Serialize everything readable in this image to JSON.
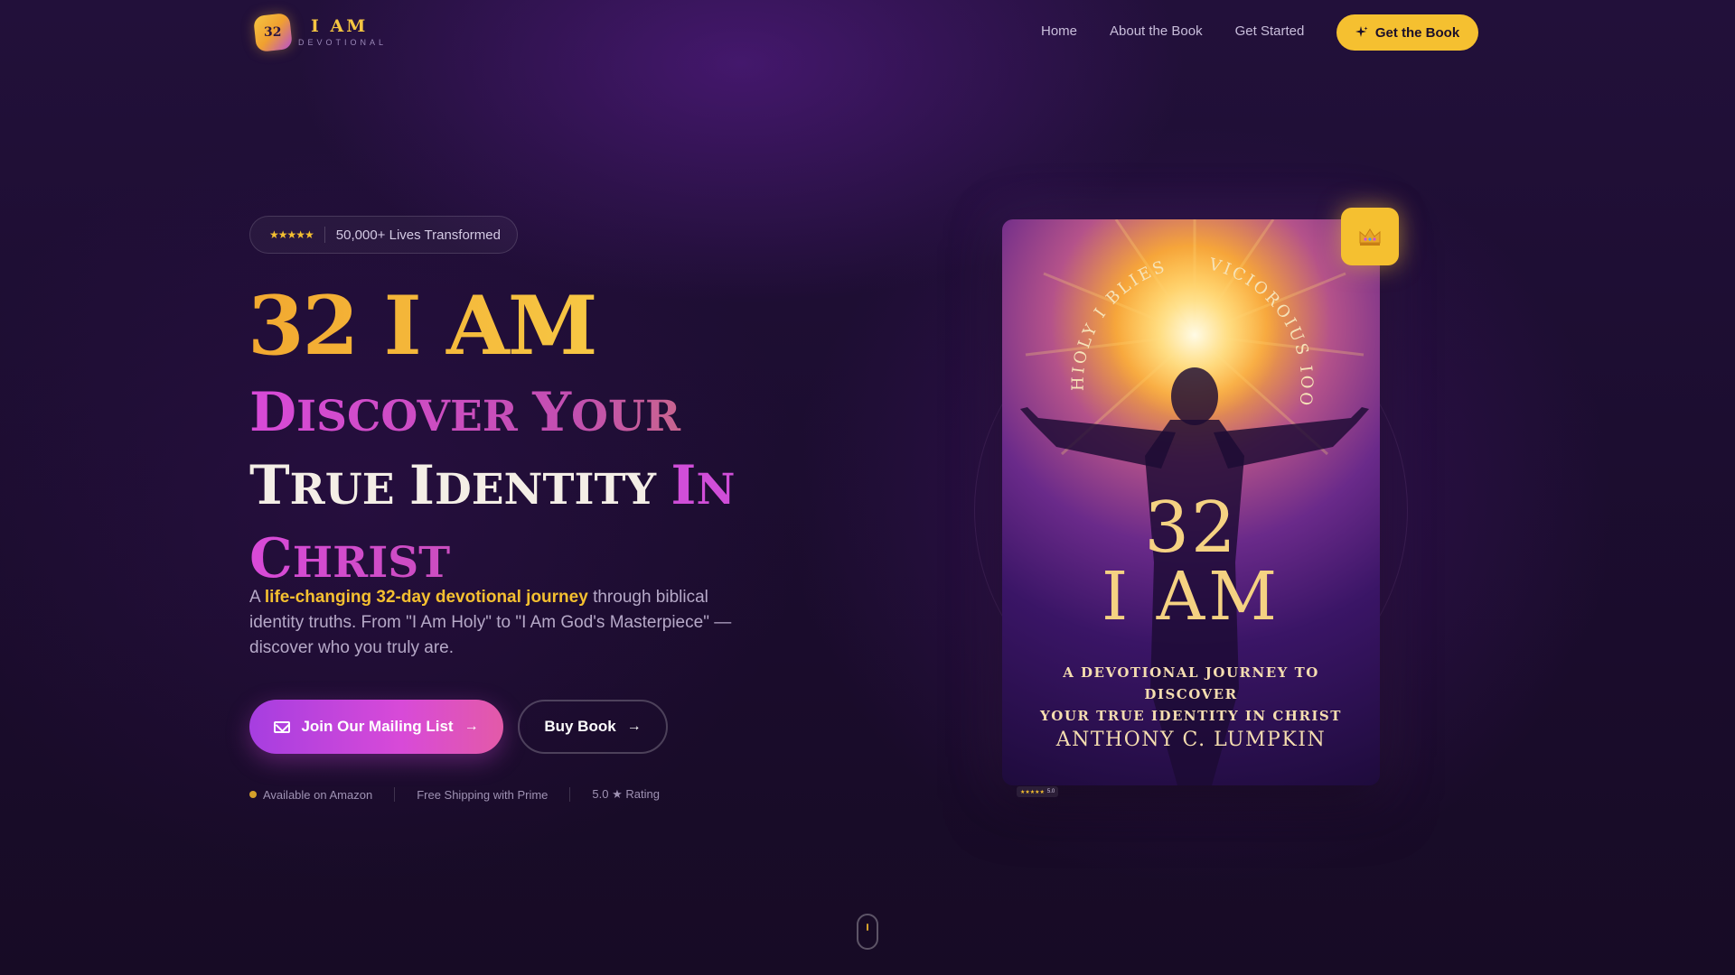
{
  "nav": {
    "logo_badge": "32",
    "logo_title": "I AM",
    "logo_sub": "DEVOTIONAL",
    "links": [
      "Home",
      "About the Book",
      "Get Started"
    ],
    "cta": "Get the Book"
  },
  "hero": {
    "rating_stars": "★★★★★",
    "rating_text": "50,000+ Lives Transformed",
    "title": "32 I AM",
    "subtitle": {
      "line1_a_big": "D",
      "line1_a_sm": "ISCOVER ",
      "line1_b_big": "Y",
      "line1_b_sm": "OUR",
      "line2_a_big": "T",
      "line2_a_sm": "RUE ",
      "line2_b_big": "I",
      "line2_b_sm": "DENTITY ",
      "line2_c_big": "I",
      "line2_c_sm": "N",
      "line3_big": "C",
      "line3_sm": "HRIST"
    },
    "desc_pre": "A ",
    "desc_highlight": "life-changing 32-day devotional journey",
    "desc_post": " through biblical identity truths. From \"I Am Holy\" to \"I Am God's Masterpiece\" — discover who you truly are.",
    "btn_primary": "Join Our Mailing List",
    "btn_secondary": "Buy Book",
    "features": [
      "Available on Amazon",
      "Free Shipping with Prime",
      "5.0 ★ Rating"
    ]
  },
  "book": {
    "arc_left": "HIOLY I BLIESSES",
    "arc_right": "VICIOROIUS IOOLS.",
    "number": "32",
    "title": "I AM",
    "tagline_1": "A DEVOTIONAL JOURNEY TO DISCOVER",
    "tagline_2": "YOUR TRUE IDENTITY IN CHRIST",
    "author": "ANTHONY C. LUMPKIN",
    "mini_stars": "★★★★★",
    "mini_rating": "5.0"
  },
  "colors": {
    "gold": "#f5c030",
    "pink": "#d84ad8",
    "purple_bg": "#1c0d30"
  },
  "icons": [
    "sparkle-icon",
    "mail-icon",
    "arrow-right-icon",
    "crown-icon",
    "star-icon",
    "scroll-mouse-icon"
  ]
}
